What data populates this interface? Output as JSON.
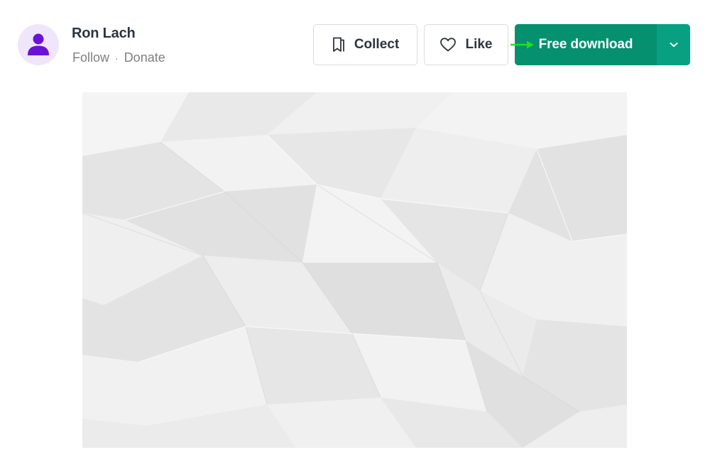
{
  "author": {
    "name": "Ron Lach",
    "follow_label": "Follow",
    "separator": "·",
    "donate_label": "Donate"
  },
  "actions": {
    "collect_label": "Collect",
    "like_label": "Like",
    "download_label": "Free download"
  },
  "icons": {
    "avatar": "user-icon",
    "collect": "bookmark-icon",
    "like": "heart-icon",
    "dropdown": "chevron-down-icon",
    "annotation": "arrow-right-icon"
  },
  "colors": {
    "download_primary": "#05906f",
    "download_secondary": "#07a081",
    "avatar_bg": "#efe6fb",
    "avatar_icon": "#6a12d8",
    "annotation_arrow": "#22dd22"
  },
  "photo": {
    "subject": "crumpled white paper texture"
  }
}
